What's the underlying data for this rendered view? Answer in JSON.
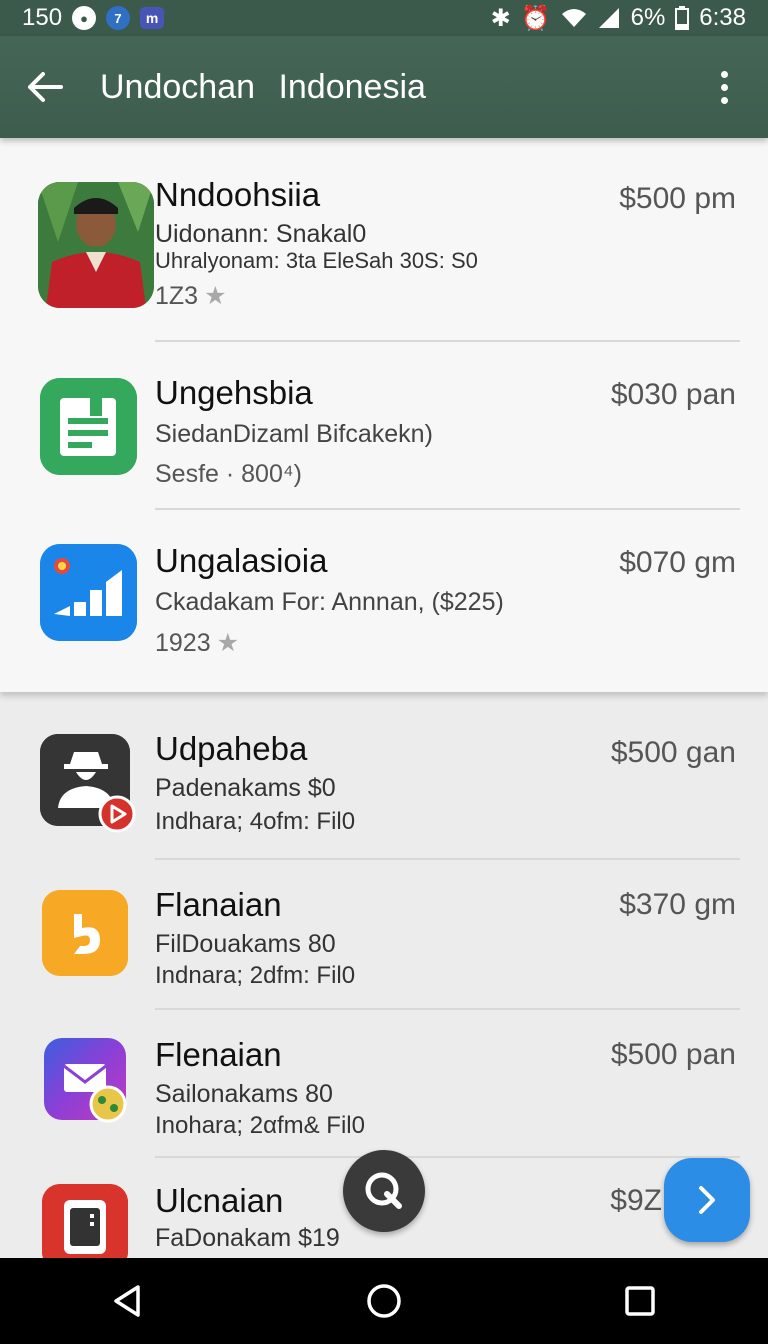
{
  "status_bar": {
    "time_left": "150",
    "battery": "6%",
    "time": "6:38"
  },
  "app_bar": {
    "title": "Undochan Indonesia"
  },
  "items": [
    {
      "title": "Nndoohsiia",
      "price": "$500 pm",
      "line1": "Uidonann: Snakal0",
      "line2": "Uhralyonam: 3ta EleSah 30S: S0",
      "meta": "1Z3",
      "icon": "person-photo-icon"
    },
    {
      "title": "Ungehsbia",
      "price": "$030 pan",
      "line1": "SiedanDizaml Bifcakekn)",
      "meta": "Sesfe  ·  800⁴)",
      "icon": "form-document-icon"
    },
    {
      "title": "Ungalasioia",
      "price": "$070 gm",
      "line1": "Ckadakam For: Annnan, ($225)",
      "meta": "1923",
      "icon": "signal-bars-icon"
    },
    {
      "title": "Udpaheba",
      "price": "$500 gan",
      "line1": "Padenakams $0",
      "line2": "Indhara; 4ofm: Fil0",
      "icon": "spy-profile-icon"
    },
    {
      "title": "Flanaian",
      "price": "$370 gm",
      "line1": "FilDouakams 80",
      "line2": "Indnara; 2dfm: Fil0",
      "icon": "b-logo-icon"
    },
    {
      "title": "Flenaian",
      "price": "$500 pan",
      "line1": "Sailonakams 80",
      "line2": "Inohara; 2αfm& Fil0",
      "icon": "mail-icon"
    },
    {
      "title": "Ulcnaian",
      "price": "$9Z",
      "line1": "FaDonakam $19",
      "icon": "phone-case-icon"
    }
  ],
  "colors": {
    "app_bar": "#3d5c4d",
    "fab_blue": "#2b8de6",
    "fab_dark": "#3a3a3a"
  }
}
